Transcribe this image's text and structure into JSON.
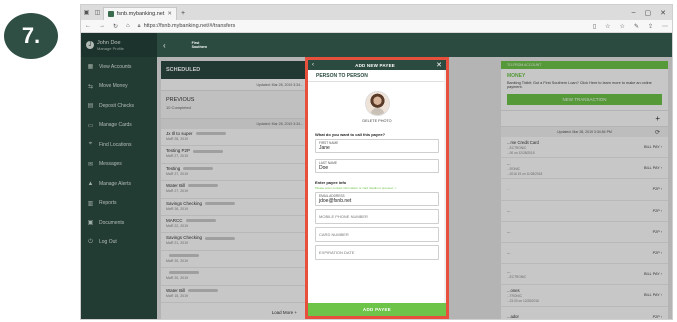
{
  "step": "7.",
  "browser": {
    "tab_title": "fsnb.mybanking.net",
    "url": "https://fsnb.mybanking.net/#/transfers",
    "new_tab": "+",
    "win_min": "–",
    "win_max": "▢",
    "win_close": "✕"
  },
  "app": {
    "user": {
      "initial": "J",
      "name": "John Doe",
      "sub": "Manage Profile"
    },
    "logo": {
      "line1": "First",
      "line2": "Southern"
    },
    "nav": [
      {
        "icon": "▦",
        "label": "View Accounts"
      },
      {
        "icon": "⇆",
        "label": "Move Money"
      },
      {
        "icon": "▤",
        "label": "Deposit Checks"
      },
      {
        "icon": "▭",
        "label": "Manage Cards"
      },
      {
        "icon": "⌖",
        "label": "Find Locations"
      },
      {
        "icon": "✉",
        "label": "Messages"
      },
      {
        "icon": "▲",
        "label": "Manage Alerts"
      },
      {
        "icon": "▥",
        "label": "Reports"
      },
      {
        "icon": "▣",
        "label": "Documents"
      },
      {
        "icon": "⏻",
        "label": "Log Out"
      }
    ],
    "scheduled": {
      "title": "SCHEDULED",
      "updated": "Updated: Mar 28, 2019 3:34..."
    },
    "previous": {
      "title": "PREVIOUS",
      "subtitle": "10 Completed",
      "updated": "Updated: Mar 28, 2019 3:34..."
    },
    "transactions": [
      {
        "name": "Jx Ill to super",
        "date": "MaR 28, 2019"
      },
      {
        "name": "Testing P2P",
        "date": "MaR 27, 2019"
      },
      {
        "name": "Testing",
        "date": "MaR 27, 2019"
      },
      {
        "name": "Water Bill",
        "date": "MaR 27, 2019"
      },
      {
        "name": "Savings Checking",
        "date": "MaR 26, 2019"
      },
      {
        "name": "MARCC",
        "date": "MaR 22, 2019"
      },
      {
        "name": "Savings Checking",
        "date": "MaR 21, 2019"
      },
      {
        "name": "",
        "date": "MaR 20, 2019"
      },
      {
        "name": "",
        "date": "MaR 20, 2019"
      },
      {
        "name": "Water Bill",
        "date": "MaR 15, 2019"
      }
    ],
    "load_more": "Load More +",
    "right": {
      "strip": "TO-FROM ACCOUNT",
      "money_title": "MONEY",
      "money_text": "Banking Tidbit:  Got a First Southern Loan? Click Here to learn more to make an online payment.",
      "new_tx": "NEW TRANSACTION",
      "add": "+",
      "updated": "Updated: Mar 28, 2019 3:34:54 PM",
      "refresh": "⟳",
      "items": [
        {
          "name": "...me Credit Card",
          "sub": "...ECTRONIC",
          "date": "...00 on 12/28/2018",
          "tag": "BILL PAY ›"
        },
        {
          "name": "...",
          "sub": "...RONIC",
          "date": "...2016 19 on 11/28/2018",
          "tag": "BILL PAY ›"
        },
        {
          "name": "",
          "sub": "...",
          "date": "",
          "tag": "P2P ›"
        },
        {
          "name": "...",
          "sub": "",
          "date": "",
          "tag": "P2P ›"
        },
        {
          "name": "...",
          "sub": "",
          "date": "",
          "tag": "P2P ›"
        },
        {
          "name": "...",
          "sub": "",
          "date": "",
          "tag": "P2P ›"
        },
        {
          "name": "...",
          "sub": "...ECTRONIC",
          "date": "",
          "tag": "BILL PAY ›"
        },
        {
          "name": "...ones",
          "sub": "...TRONIC",
          "date": "...23.00 on 12/28/2016",
          "tag": "BILL PAY ›"
        },
        {
          "name": "...ador",
          "sub": "",
          "date": "",
          "tag": "P2P ›"
        }
      ]
    }
  },
  "modal": {
    "title": "ADD NEW PAYEE",
    "back": "‹",
    "close": "✕",
    "section": "PERSON TO PERSON",
    "delete_photo": "DELETE PHOTO",
    "question": "What do you want to call this payee?",
    "first_name": {
      "label": "FIRST NAME",
      "value": "Jane"
    },
    "last_name": {
      "label": "LAST NAME",
      "value": "Doe"
    },
    "info_title": "Enter payee info",
    "info_sub": "Please enter contact information or card details to proceed. ✓",
    "email": {
      "label": "EMAIL ADDRESS",
      "value": "jdoe@fsnb.net"
    },
    "mobile_placeholder": "MOBILE PHONE NUMBER",
    "card_placeholder": "CARD NUMBER",
    "exp_placeholder": "EXPIRATION DATE",
    "submit": "ADD PAYEE"
  }
}
